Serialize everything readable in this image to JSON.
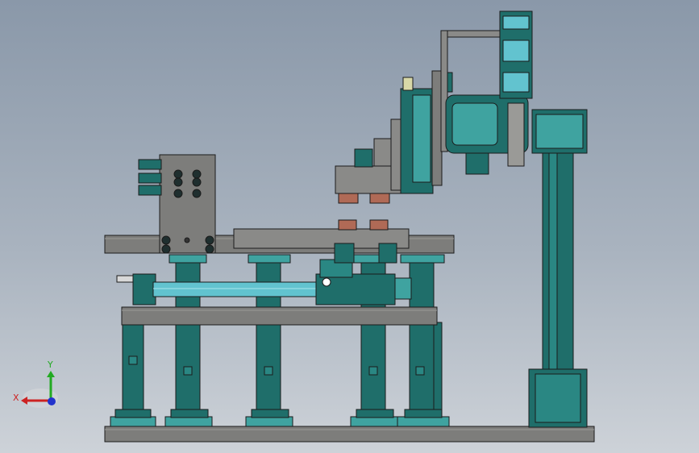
{
  "viewport": {
    "background_top": "#8a98a9",
    "background_bottom": "#cdd2d8",
    "model_colors": {
      "steel_teal": "#1f6e6a",
      "steel_teal_light": "#3fa3a0",
      "plate_gray": "#7d7d7b",
      "plate_gray_light": "#9a9a97",
      "pad_copper": "#b06a56",
      "rod_cyan": "#62c3cf",
      "edge": "#1b1b1b"
    }
  },
  "triad": {
    "x_label": "X",
    "y_label": "Y",
    "x_color": "#cc2222",
    "y_color": "#22aa22",
    "z_color": "#2233cc"
  }
}
